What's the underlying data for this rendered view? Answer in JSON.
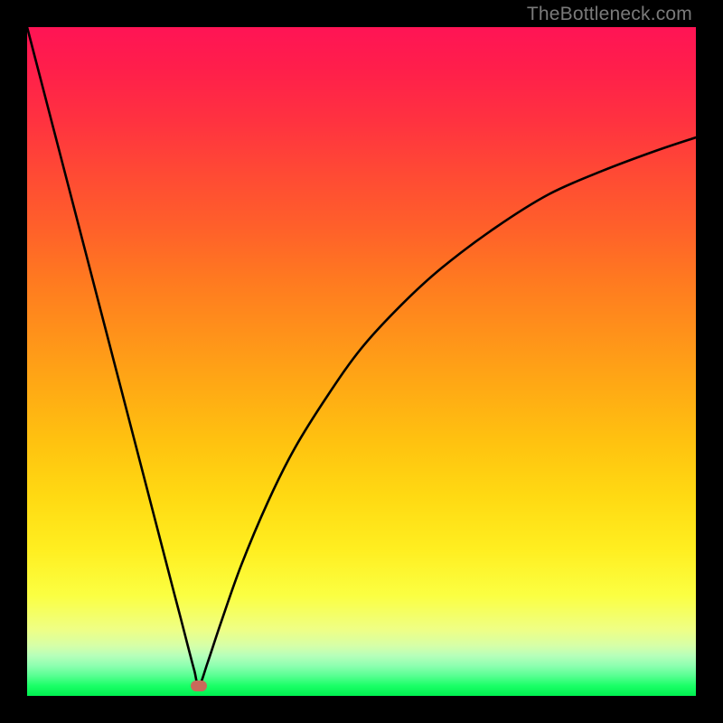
{
  "watermark": "TheBottleneck.com",
  "chart_data": {
    "type": "line",
    "title": "",
    "xlabel": "",
    "ylabel": "",
    "xlim": [
      0,
      100
    ],
    "ylim": [
      0,
      100
    ],
    "grid": false,
    "background_gradient": {
      "top_color": "#ff1455",
      "mid_colors": [
        "#ff7a20",
        "#ffd912",
        "#efff84"
      ],
      "bottom_color": "#00f050"
    },
    "minimum_point": {
      "x": 25.7,
      "y": 1.5
    },
    "series": [
      {
        "name": "bottleneck-curve",
        "x": [
          0,
          2,
          4,
          6,
          8,
          10,
          12,
          14,
          16,
          18,
          20,
          22,
          23,
          24,
          25,
          25.7,
          27,
          29,
          32,
          36,
          40,
          45,
          50,
          56,
          62,
          70,
          78,
          86,
          94,
          100
        ],
        "y": [
          100,
          92.3,
          84.6,
          76.9,
          69.2,
          61.5,
          53.8,
          46.1,
          38.4,
          30.7,
          23.0,
          15.3,
          11.5,
          7.6,
          3.8,
          1.5,
          5.0,
          11.0,
          19.5,
          29.0,
          37.0,
          45.0,
          52.0,
          58.5,
          64.0,
          70.0,
          75.0,
          78.5,
          81.5,
          83.5
        ]
      }
    ]
  }
}
